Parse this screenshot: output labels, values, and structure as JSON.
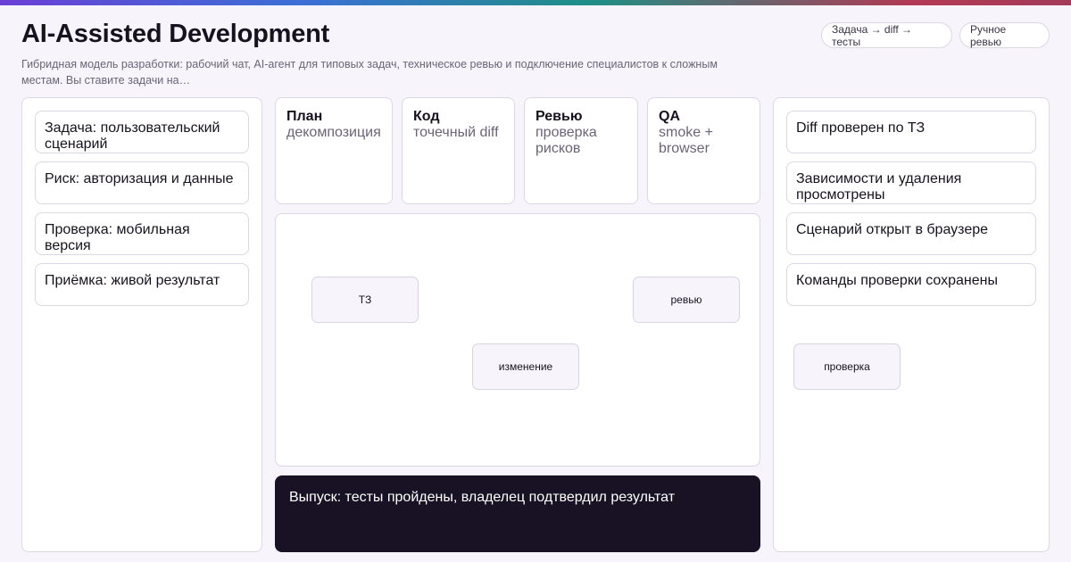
{
  "header": {
    "title": "AI-Assisted Development",
    "subtitle": "Гибридная модель разработки: рабочий чат, AI-агент для типовых задач, техническое ревью и подключение специалистов к сложным местам. Вы ставите задачи на…",
    "chips": [
      "Задача → diff → тесты",
      "Ручное ревью"
    ]
  },
  "left_cards": [
    "Задача: пользовательский сценарий",
    "Риск: авторизация и данные",
    "Проверка: мобильная версия",
    "Приёмка: живой результат"
  ],
  "steps": [
    {
      "title": "План",
      "desc": "декомпозиция"
    },
    {
      "title": "Код",
      "desc": "точечный diff"
    },
    {
      "title": "Ревью",
      "desc": "проверка рисков"
    },
    {
      "title": "QA",
      "desc": "smoke + browser"
    }
  ],
  "nodes": {
    "tz": "ТЗ",
    "review": "ревью",
    "change": "изменение",
    "check": "проверка"
  },
  "right_cards": [
    "Diff проверен по ТЗ",
    "Зависимости и удаления просмотрены",
    "Сценарий открыт в браузере",
    "Команды проверки сохранены"
  ],
  "release": "Выпуск: тесты пройдены, владелец подтвердил результат",
  "colors": {
    "background": "#f7f5fb",
    "text": "#17121f",
    "muted": "#6b6477",
    "border": "#dcd7e4",
    "dark_panel": "#181224"
  }
}
